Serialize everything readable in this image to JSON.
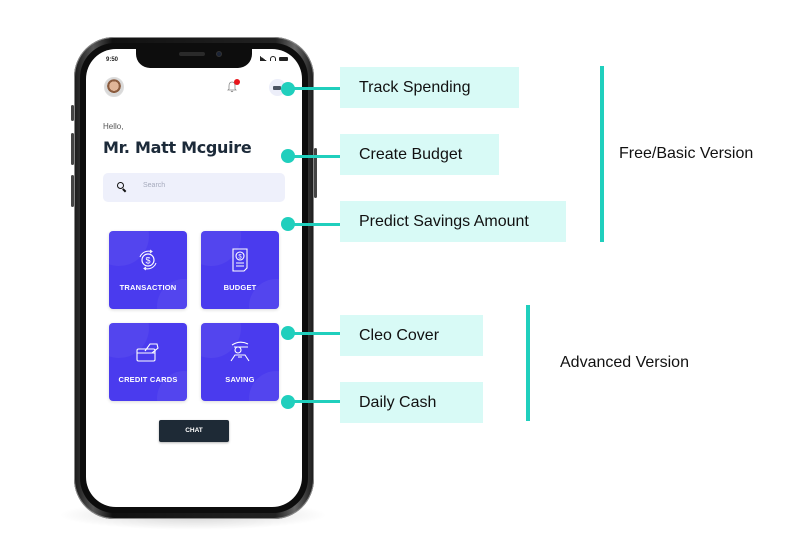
{
  "phone": {
    "status_time": "9:50",
    "greeting": "Hello,",
    "user_name": "Mr. Matt Mcguire",
    "search_placeholder": "Search",
    "notification_badge": true,
    "tiles": [
      {
        "label": "TRANSACTION",
        "icon": "dollar-cycle-icon"
      },
      {
        "label": "BUDGET",
        "icon": "budget-document-icon"
      },
      {
        "label": "CREDIT CARDS",
        "icon": "credit-card-hand-icon"
      },
      {
        "label": "SAVING",
        "icon": "saving-hand-icon"
      }
    ],
    "chat_label": "CHAT"
  },
  "callouts": [
    {
      "label": "Track Spending"
    },
    {
      "label": "Create Budget"
    },
    {
      "label": "Predict Savings Amount"
    },
    {
      "label": "Cleo Cover"
    },
    {
      "label": "Daily Cash"
    }
  ],
  "groups": [
    {
      "label": "Free/Basic Version"
    },
    {
      "label": "Advanced Version"
    }
  ],
  "colors": {
    "accent": "#20cfbd",
    "callout_bg": "#d8faf6",
    "tile_bg": "#4a3bee",
    "chat_bg": "#1e2a36"
  }
}
